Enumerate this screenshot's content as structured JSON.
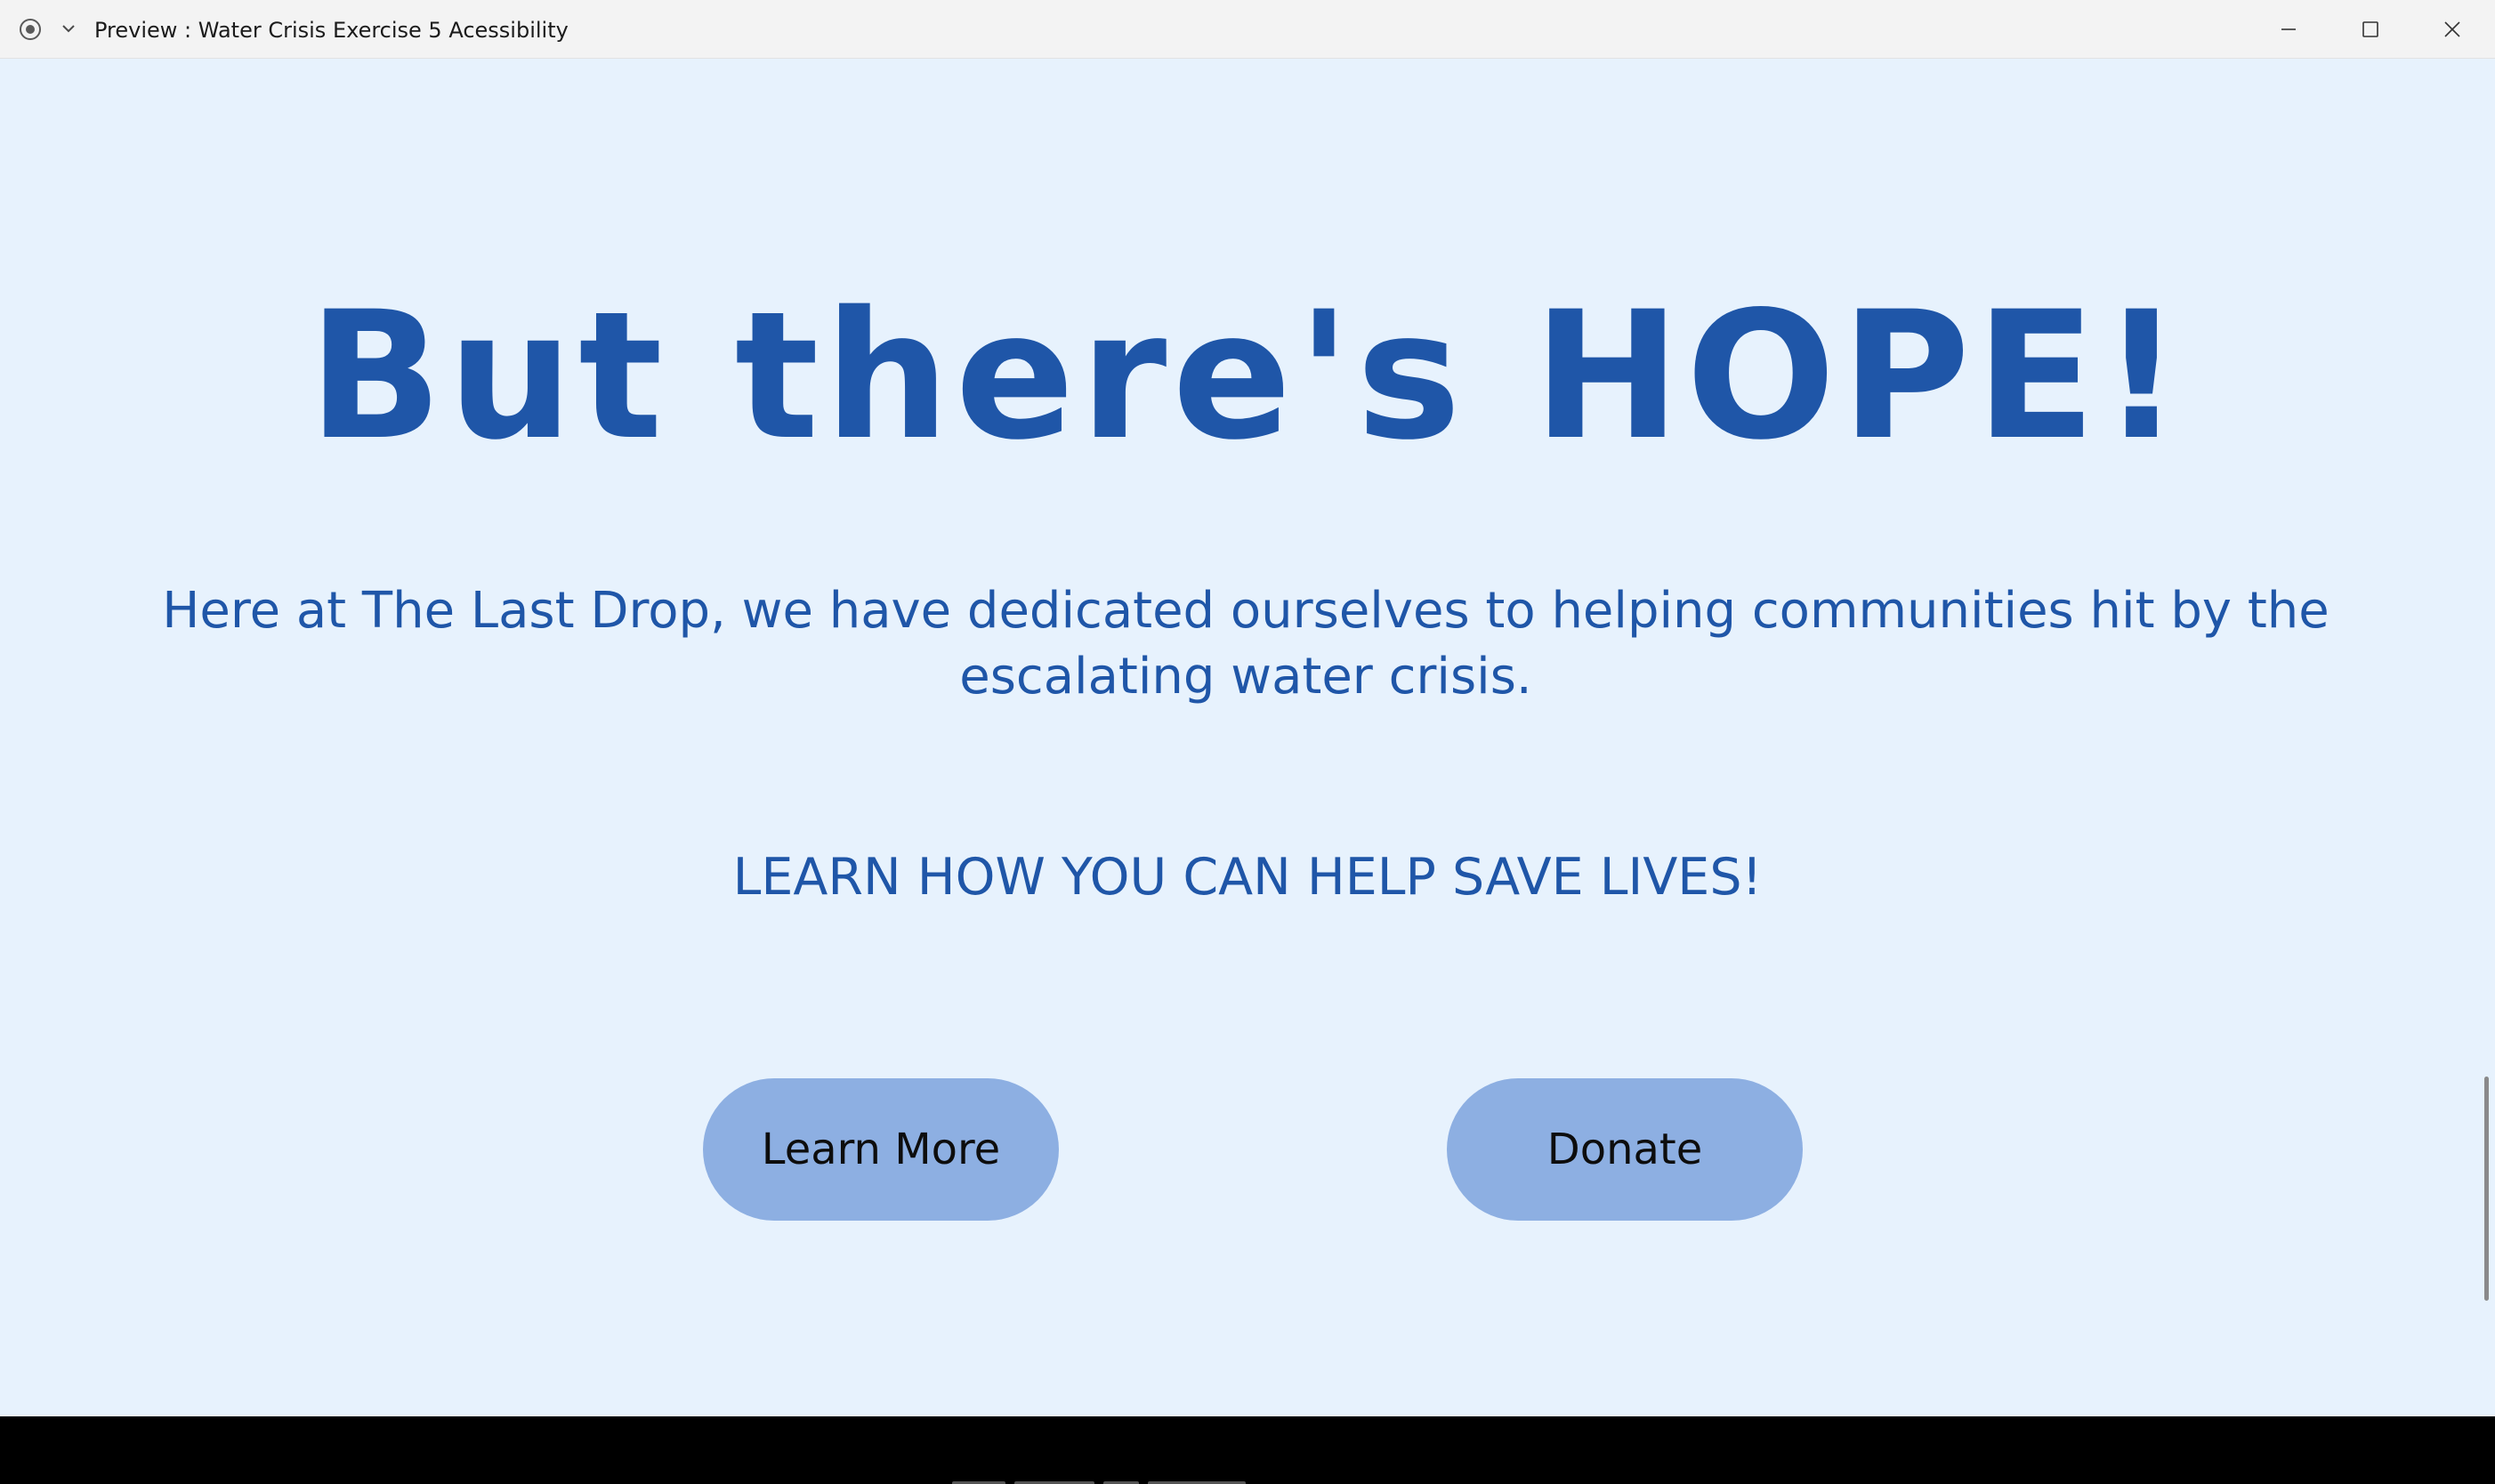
{
  "window": {
    "title": "Preview : Water Crisis Exercise 5 Acessibility",
    "controls": {
      "minimize_icon": "minimize-icon",
      "maximize_icon": "maximize-icon",
      "close_icon": "close-icon"
    },
    "app_icon": "record-icon",
    "menu_icon": "chevron-down-icon"
  },
  "page": {
    "headline": "But there's HOPE!",
    "intro": "Here at The Last Drop, we have dedicated ourselves to helping communities hit by the escalating water crisis.",
    "cta": "LEARN HOW YOU CAN HELP SAVE LIVES!",
    "buttons": {
      "learn_more": "Learn More",
      "donate": "Donate"
    }
  },
  "colors": {
    "background": "#e7f2fd",
    "text_primary": "#1f56a8",
    "button_fill": "#8dafe2",
    "button_text": "#0d0d0d",
    "footer": "#000000"
  }
}
